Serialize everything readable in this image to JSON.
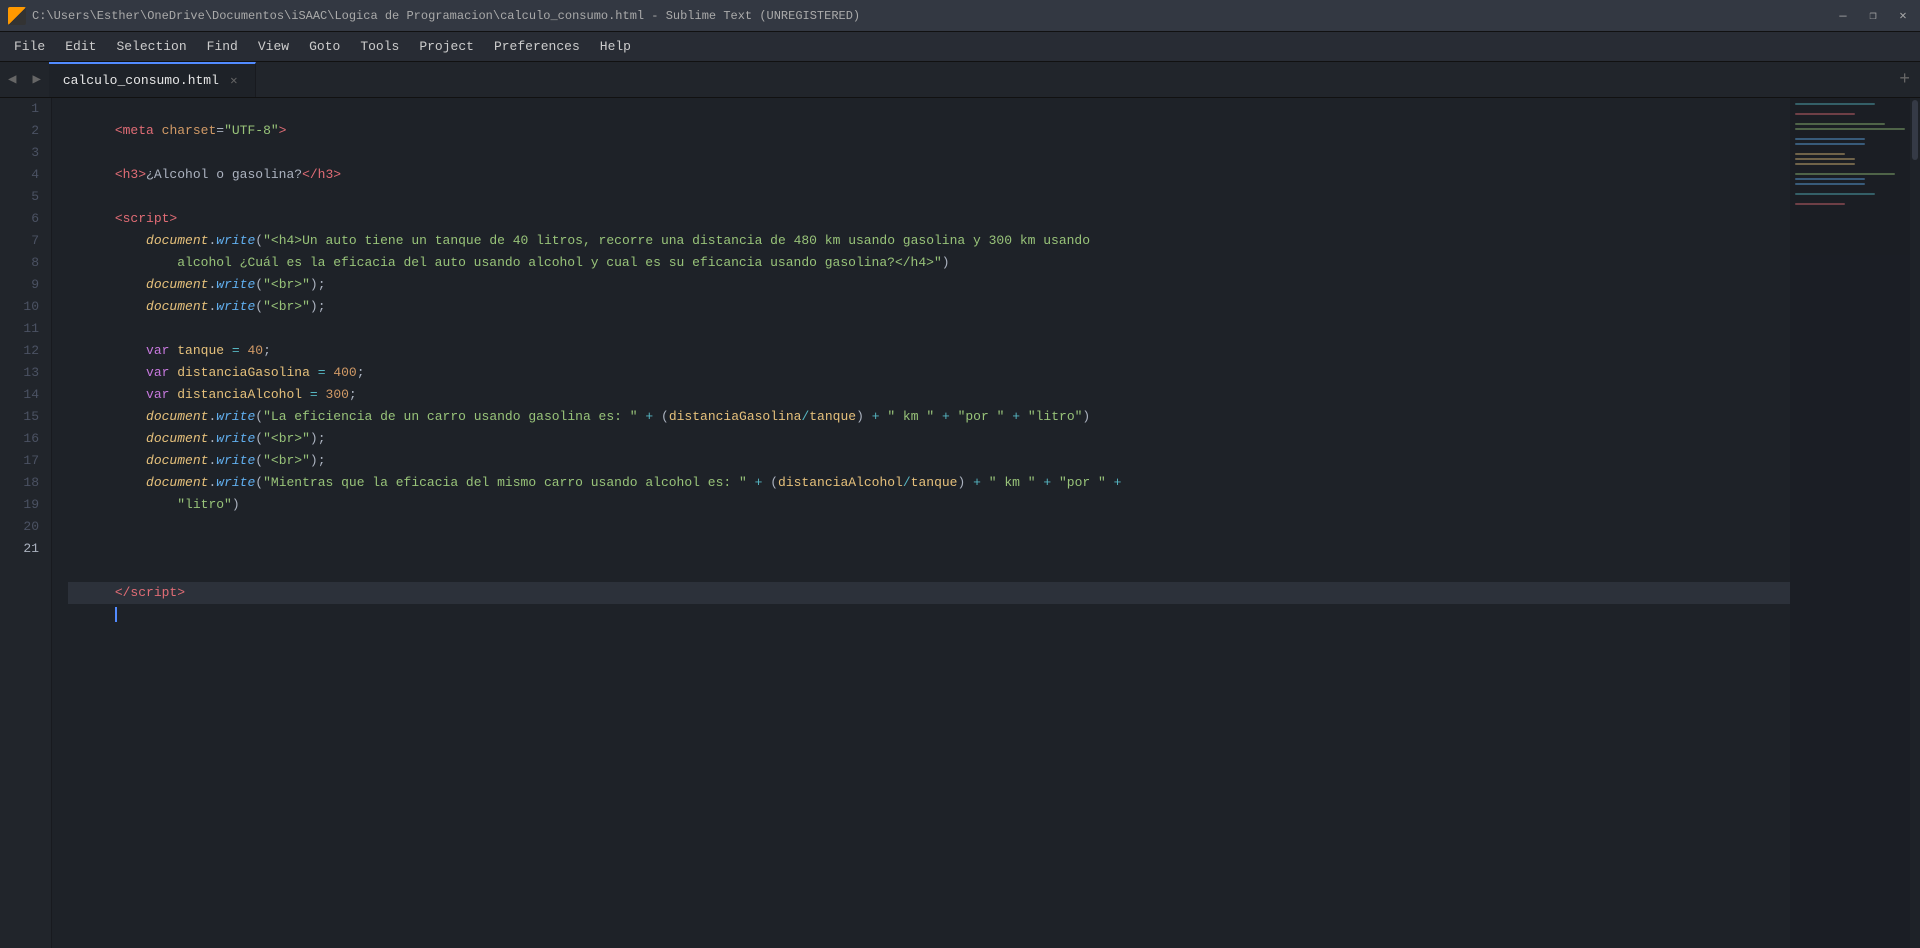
{
  "titlebar": {
    "icon_alt": "sublime-text-icon",
    "title": "C:\\Users\\Esther\\OneDrive\\Documentos\\iSAAC\\Logica de Programacion\\calculo_consumo.html - Sublime Text (UNREGISTERED)",
    "minimize_label": "—",
    "maximize_label": "❐",
    "close_label": "✕"
  },
  "menubar": {
    "items": [
      {
        "id": "file",
        "label": "File"
      },
      {
        "id": "edit",
        "label": "Edit"
      },
      {
        "id": "selection",
        "label": "Selection"
      },
      {
        "id": "find",
        "label": "Find"
      },
      {
        "id": "view",
        "label": "View"
      },
      {
        "id": "goto",
        "label": "Goto"
      },
      {
        "id": "tools",
        "label": "Tools"
      },
      {
        "id": "project",
        "label": "Project"
      },
      {
        "id": "preferences",
        "label": "Preferences"
      },
      {
        "id": "help",
        "label": "Help"
      }
    ]
  },
  "tabbar": {
    "prev_label": "◀",
    "next_label": "▶",
    "tab_label": "calculo_consumo.html",
    "tab_close": "✕",
    "new_tab_label": "+"
  },
  "editor": {
    "lines": [
      {
        "num": "1",
        "content": ""
      },
      {
        "num": "2",
        "content": ""
      },
      {
        "num": "3",
        "content": ""
      },
      {
        "num": "4",
        "content": ""
      },
      {
        "num": "5",
        "content": ""
      },
      {
        "num": "6",
        "content": ""
      },
      {
        "num": "7",
        "content": ""
      },
      {
        "num": "8",
        "content": ""
      },
      {
        "num": "9",
        "content": ""
      },
      {
        "num": "10",
        "content": ""
      },
      {
        "num": "11",
        "content": ""
      },
      {
        "num": "12",
        "content": ""
      },
      {
        "num": "13",
        "content": ""
      },
      {
        "num": "14",
        "content": ""
      },
      {
        "num": "15",
        "content": ""
      },
      {
        "num": "16",
        "content": ""
      },
      {
        "num": "17",
        "content": ""
      },
      {
        "num": "18",
        "content": ""
      },
      {
        "num": "19",
        "content": ""
      },
      {
        "num": "20",
        "content": ""
      },
      {
        "num": "21",
        "content": ""
      }
    ]
  }
}
